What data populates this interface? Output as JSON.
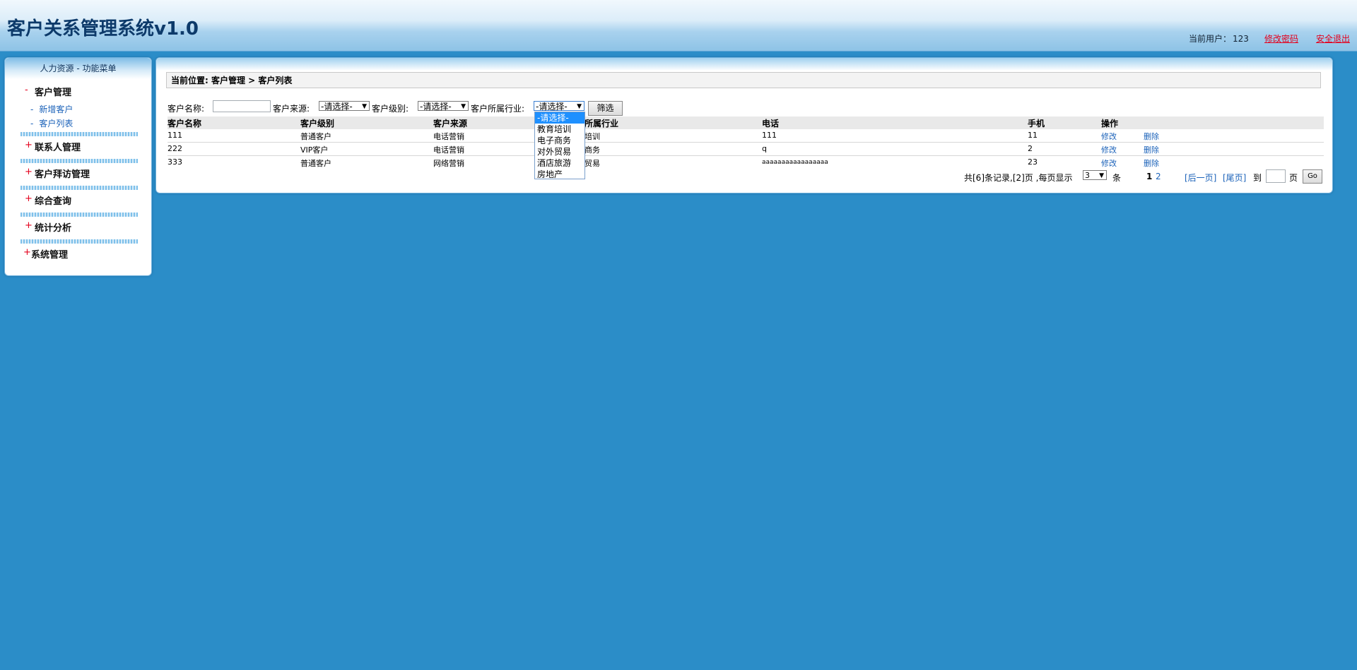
{
  "header": {
    "title": "客户关系管理系统v1.0",
    "current_user_label": "当前用户：",
    "current_user": "123",
    "change_password": "修改密码",
    "logout": "安全退出"
  },
  "sidebar": {
    "title": "人力资源  - 功能菜单",
    "groups": [
      {
        "sign": "-",
        "label": "客户管理",
        "children": [
          {
            "label": "新增客户"
          },
          {
            "label": "客户列表"
          }
        ]
      },
      {
        "sign": "+",
        "label": "联系人管理"
      },
      {
        "sign": "+",
        "label": "客户拜访管理"
      },
      {
        "sign": "+",
        "label": "综合查询"
      },
      {
        "sign": "+",
        "label": "统计分析"
      },
      {
        "sign": "+",
        "label": "系统管理"
      }
    ]
  },
  "main": {
    "breadcrumb": "当前位置: 客户管理 > 客户列表",
    "filter": {
      "name_label": "客户名称:",
      "name_value": "",
      "source_label": "客户来源:",
      "source_value": "-请选择-",
      "level_label": "客户级别:",
      "level_value": "-请选择-",
      "industry_label": "客户所属行业:",
      "industry_value": "-请选择-",
      "submit": "筛选",
      "industry_options": [
        "-请选择-",
        "教育培训",
        "电子商务",
        "对外贸易",
        "酒店旅游",
        "房地产"
      ]
    },
    "table": {
      "columns": [
        "客户名称",
        "客户级别",
        "客户来源",
        "所属行业",
        "电话",
        "手机",
        "操作"
      ],
      "rows": [
        {
          "name": "111",
          "level": "普通客户",
          "source": "电话营销",
          "industry": "培训",
          "phone": "111",
          "mobile": "11",
          "edit": "修改",
          "delete": "删除"
        },
        {
          "name": "222",
          "level": "VIP客户",
          "source": "电话营销",
          "industry": "商务",
          "phone": "q",
          "mobile": "2",
          "edit": "修改",
          "delete": "删除"
        },
        {
          "name": "333",
          "level": "普通客户",
          "source": "网络营销",
          "industry": "贸易",
          "phone": "aaaaaaaaaaaaaaaaa",
          "mobile": "23",
          "edit": "修改",
          "delete": "删除"
        }
      ]
    },
    "pager": {
      "summary": "共[6]条记录,[2]页 ,每页显示",
      "page_size": "3",
      "unit": "条",
      "page1": "1",
      "page2": "2",
      "next": "[后一页]",
      "last": "[尾页]",
      "to": "到",
      "page_suffix": "页",
      "go": "Go"
    }
  }
}
